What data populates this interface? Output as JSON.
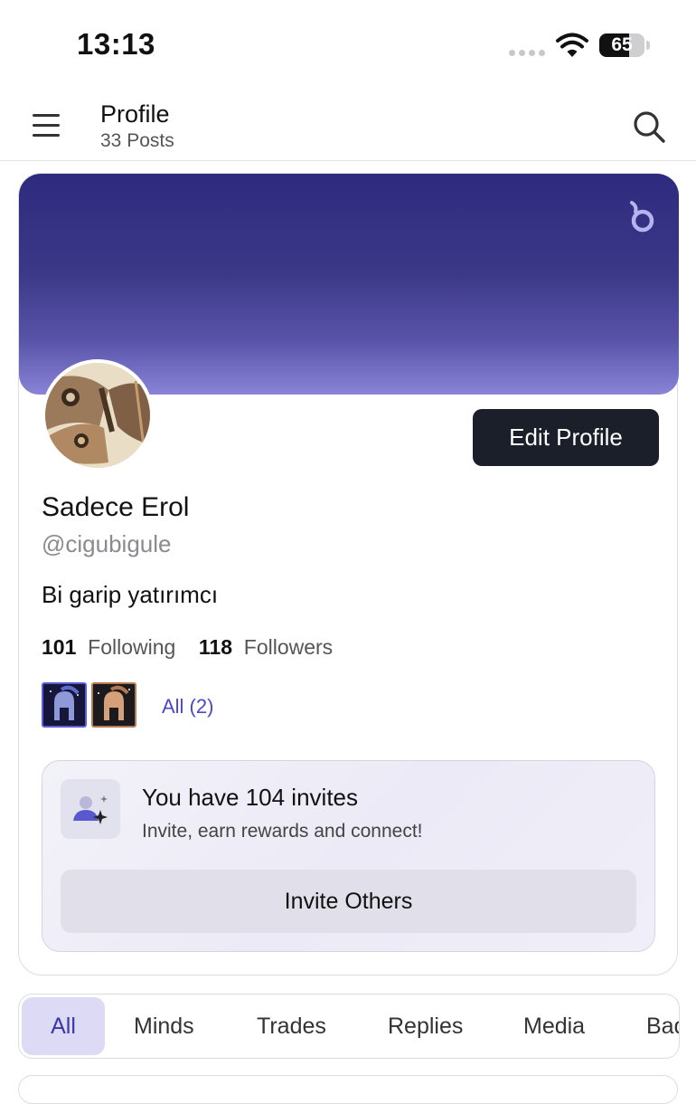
{
  "status_bar": {
    "time": "13:13",
    "battery_percent": "65",
    "battery_level": 0.65
  },
  "header": {
    "title": "Profile",
    "post_count": "33 Posts"
  },
  "profile": {
    "display_name": "Sadece Erol",
    "handle": "@cigubigule",
    "bio": "Bi garip yatırımcı",
    "following_count": "101",
    "following_label": "Following",
    "followers_count": "118",
    "followers_label": "Followers",
    "edit_button": "Edit Profile",
    "badges_all_label": "All (2)"
  },
  "invite": {
    "title": "You have 104 invites",
    "subtitle": "Invite, earn rewards and connect!",
    "button": "Invite Others"
  },
  "tabs": [
    {
      "label": "All",
      "active": true
    },
    {
      "label": "Minds",
      "active": false
    },
    {
      "label": "Trades",
      "active": false
    },
    {
      "label": "Replies",
      "active": false
    },
    {
      "label": "Media",
      "active": false
    },
    {
      "label": "Badges",
      "active": false
    }
  ],
  "colors": {
    "accent": "#4a48c4",
    "banner_top": "#2e2a7e",
    "banner_bottom": "#8a84d8",
    "button_dark": "#1b1f2a"
  }
}
